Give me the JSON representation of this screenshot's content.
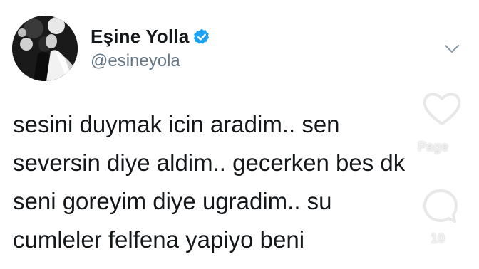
{
  "profile": {
    "display_name": "Eşine Yolla",
    "handle": "@esineyola",
    "verified": true,
    "avatar": "wedding-couple-photo"
  },
  "menu": {
    "icon": "chevron-down-icon"
  },
  "tweet": {
    "lines": [
      "sesini duymak icin aradim.. sen",
      "seversin diye aldim.. gecerken bes dk",
      "seni goreyim diye ugradim.. su",
      "cumleler felfena yapiyo beni"
    ]
  },
  "overlay": {
    "like_icon": "heart-icon",
    "page_label": "Page",
    "comment_icon": "comment-icon",
    "comment_count": "10"
  },
  "colors": {
    "text": "#14171a",
    "secondary": "#657786",
    "verified_badge": "#1da1f2",
    "background": "#ffffff"
  }
}
